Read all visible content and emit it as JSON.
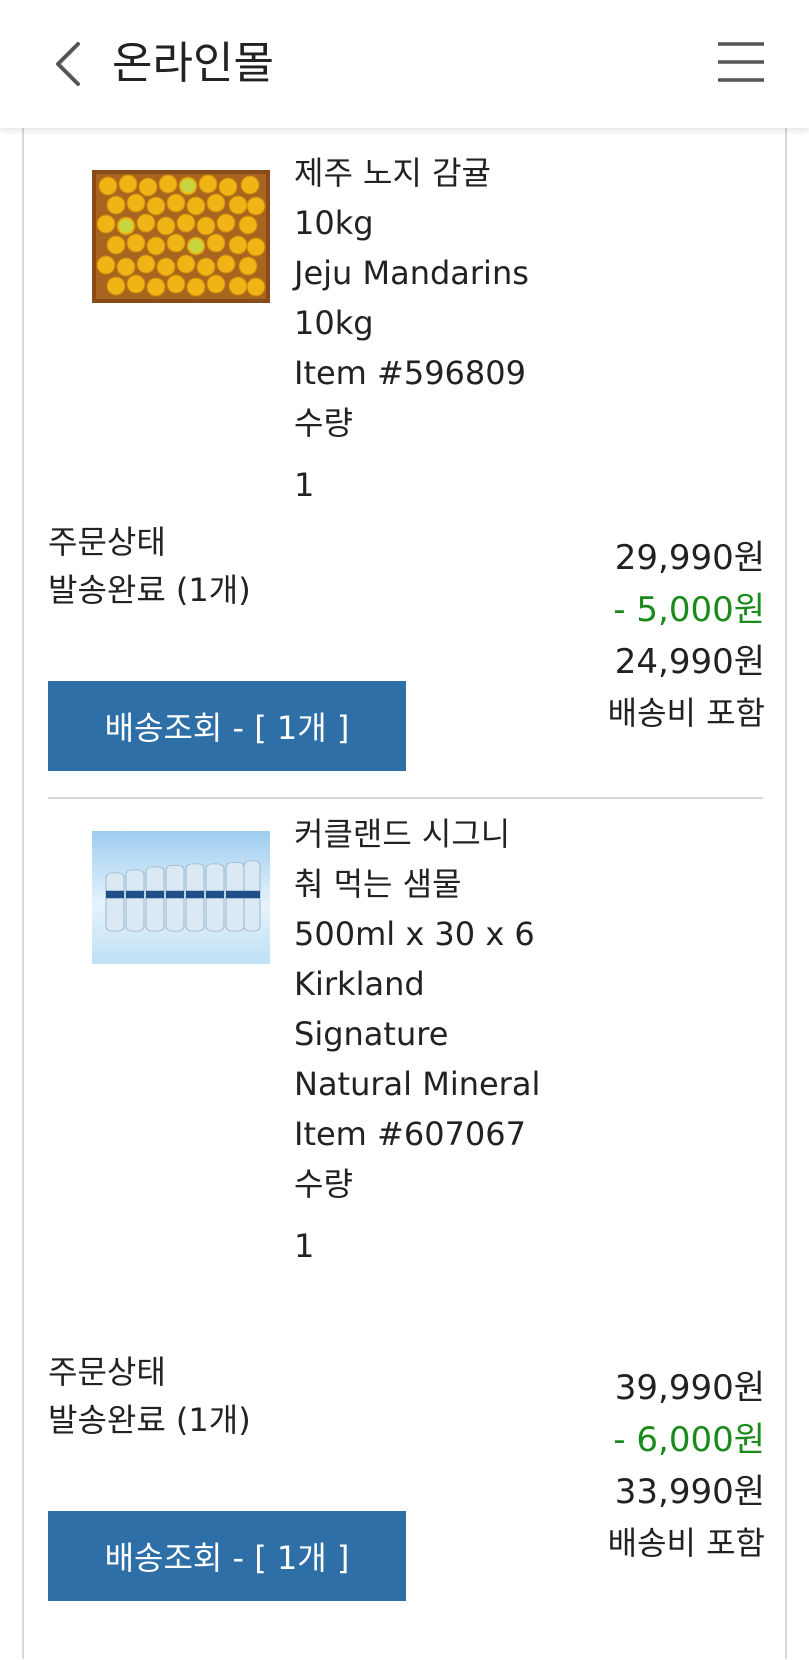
{
  "header": {
    "title": "온라인몰",
    "back_icon": "chevron-left-icon",
    "menu_icon": "hamburger-menu-icon"
  },
  "colors": {
    "button_bg": "#2e6fa8",
    "discount": "#1a8a1a"
  },
  "orders": [
    {
      "image": "mandarin-box-image",
      "name_lines": [
        "제주 노지 감귤",
        "10kg",
        "Jeju Mandarins",
        "10kg"
      ],
      "item_no": "Item #596809",
      "qty_label": "수량",
      "qty": "1",
      "status_label": "주문상태",
      "status_value": "발송완료 (1개)",
      "price": "29,990원",
      "discount": "- 5,000원",
      "final_price": "24,990원",
      "shipping_note": "배송비 포함",
      "track_button": "배송조회 - [ 1개 ]"
    },
    {
      "image": "water-bottle-pack-image",
      "name_lines": [
        "커클랜드 시그니",
        "춰 먹는 샘물",
        "500ml x 30 x 6",
        "Kirkland",
        "Signature",
        "Natural Mineral"
      ],
      "item_no": "Item #607067",
      "qty_label": "수량",
      "qty": "1",
      "status_label": "주문상태",
      "status_value": "발송완료 (1개)",
      "price": "39,990원",
      "discount": "- 6,000원",
      "final_price": "33,990원",
      "shipping_note": "배송비 포함",
      "track_button": "배송조회 - [ 1개 ]"
    }
  ]
}
